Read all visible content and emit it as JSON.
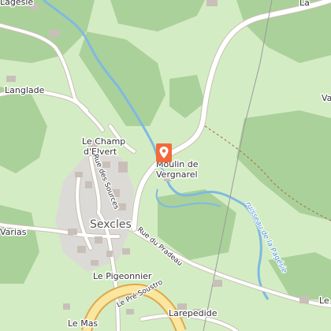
{
  "map": {
    "colors": {
      "meadow": "#d4ecc4",
      "forest": "#aad19a",
      "road": "#ffffff",
      "road_casing": "#c9c0b4",
      "main_road": "#fbe6a0",
      "main_road_casing": "#e0a84a",
      "water": "#7fb9e0",
      "building": "#c8c0b8",
      "residential": "#dcdad6",
      "marker": "#f26a3c"
    },
    "marker": {
      "name": "map-pin-icon"
    },
    "labels": {
      "top_left": "Lagesie",
      "top_right": "La",
      "langlade": "Langlade",
      "champ_line1": "Le Champ",
      "champ_line2": "d'Elvert",
      "moulin_line1": "Moulin de",
      "moulin_line2": "Vergnarel",
      "right_edge": "Va",
      "varias": "Varias",
      "town": "Sexcles",
      "pigeonnier": "Le Pigeonnier",
      "larepedide": "Larepedide",
      "le_mas": "Le Mas",
      "bottom_right": "Le"
    },
    "streets": {
      "sources": "Rue des Sources",
      "pradeau": "Rue du Pradeau",
      "pre_soustro": "Le Pré Soustro"
    },
    "waterways": {
      "stream": "ruisseau de la Pagésie"
    }
  }
}
